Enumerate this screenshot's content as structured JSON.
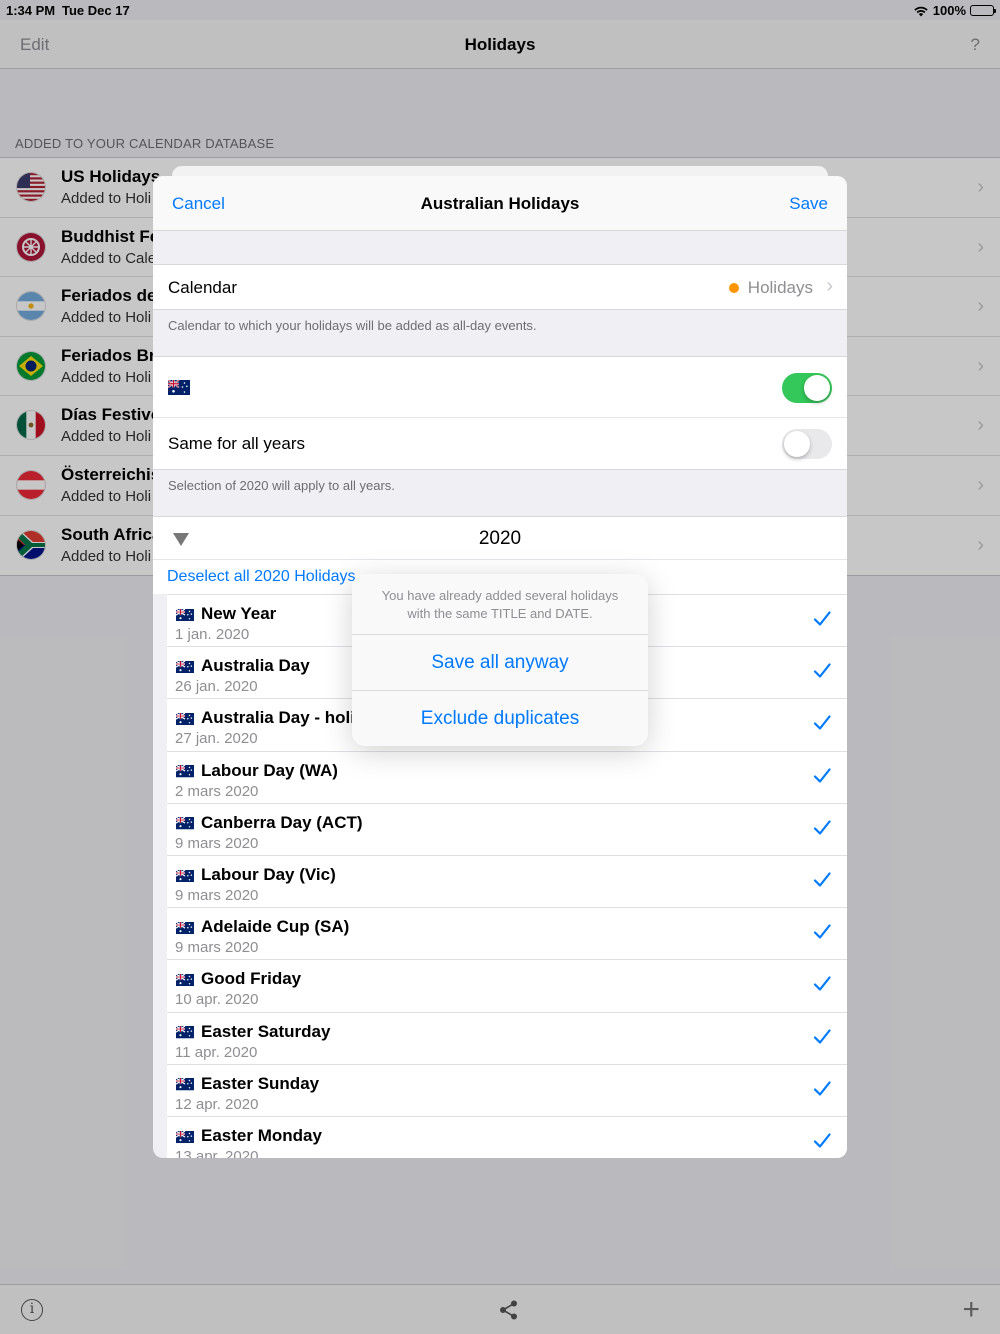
{
  "status": {
    "time": "1:34 PM",
    "date": "Tue Dec 17",
    "battery": "100%"
  },
  "navbar": {
    "edit": "Edit",
    "title": "Holidays",
    "help": "?"
  },
  "section_header": "ADDED TO YOUR CALENDAR DATABASE",
  "db_items": [
    {
      "name": "US Holidays",
      "sub": "Added to Holi"
    },
    {
      "name": "Buddhist Fe",
      "sub": "Added to Cale"
    },
    {
      "name": "Feriados de",
      "sub": "Added to Holi"
    },
    {
      "name": "Feriados Bra",
      "sub": "Added to Holi"
    },
    {
      "name": "Días Festivo",
      "sub": "Added to Holi"
    },
    {
      "name": "Österreichis",
      "sub": "Added to Holi"
    },
    {
      "name": "South Africa",
      "sub": "Added to Holi"
    }
  ],
  "sheet": {
    "cancel": "Cancel",
    "title": "Australian Holidays",
    "save": "Save",
    "calendar_label": "Calendar",
    "calendar_value": "Holidays",
    "calendar_note": "Calendar to which your holidays will be added as all-day events.",
    "same_label": "Same for all years",
    "same_note": "Selection of 2020 will apply to all years.",
    "year": "2020",
    "deselect": "Deselect all 2020 Holidays",
    "colors": {
      "accent": "#007aff",
      "switch_on": "#34c759",
      "calendar_dot": "#ff9500"
    }
  },
  "holidays": [
    {
      "name": "New Year",
      "date": "1 jan. 2020"
    },
    {
      "name": "Australia Day",
      "date": "26 jan. 2020"
    },
    {
      "name": "Australia Day - holic",
      "date": "27 jan. 2020"
    },
    {
      "name": "Labour Day (WA)",
      "date": "2 mars 2020"
    },
    {
      "name": "Canberra Day (ACT)",
      "date": "9 mars 2020"
    },
    {
      "name": "Labour Day (Vic)",
      "date": "9 mars 2020"
    },
    {
      "name": "Adelaide Cup (SA)",
      "date": "9 mars 2020"
    },
    {
      "name": "Good Friday",
      "date": "10 apr. 2020"
    },
    {
      "name": "Easter Saturday",
      "date": "11 apr. 2020"
    },
    {
      "name": "Easter Sunday",
      "date": "12 apr. 2020"
    },
    {
      "name": "Easter Monday",
      "date": "13 apr. 2020"
    }
  ],
  "alert": {
    "message_line1": "You have already added several holidays",
    "message_line2": "with the same TITLE and DATE.",
    "save_all": "Save all anyway",
    "exclude": "Exclude duplicates"
  },
  "toolbar": {
    "info": "i",
    "plus": "+"
  }
}
